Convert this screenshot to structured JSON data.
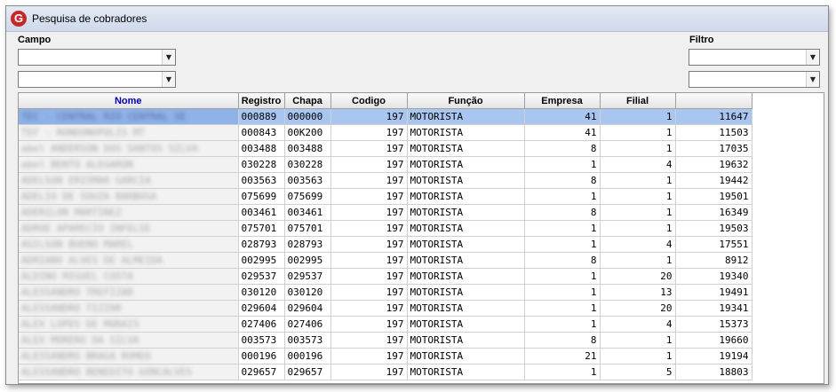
{
  "window": {
    "title": "Pesquisa de cobradores",
    "app_icon": "G"
  },
  "filters": {
    "campo_label": "Campo",
    "filtro_label": "Filtro",
    "campo_value_1": "",
    "campo_value_2": "",
    "filtro_value_1": "",
    "filtro_value_2": ""
  },
  "table": {
    "headers": [
      "Nome",
      "Registro",
      "Chapa",
      "Codigo",
      "Função",
      "Empresa",
      "Filial",
      ""
    ],
    "selected_row": 0,
    "rows": [
      {
        "nome": "TEC - CENTRAL RIO CENTRAL SE",
        "registro": "000889",
        "chapa": "000000",
        "codigo": "197",
        "funcao": "MOTORISTA",
        "empresa": "41",
        "filial": "1",
        "extra": "11647"
      },
      {
        "nome": "TEF - RONDONOPOLIS MT",
        "registro": "000843",
        "chapa": "00K200",
        "codigo": "197",
        "funcao": "MOTORISTA",
        "empresa": "41",
        "filial": "1",
        "extra": "11503"
      },
      {
        "nome": "abel ANDERSON DOS SANTOS SILVA",
        "registro": "003488",
        "chapa": "003488",
        "codigo": "197",
        "funcao": "MOTORISTA",
        "empresa": "8",
        "filial": "1",
        "extra": "17035"
      },
      {
        "nome": "abel BENTO ALEGARON",
        "registro": "030228",
        "chapa": "030228",
        "codigo": "197",
        "funcao": "MOTORISTA",
        "empresa": "1",
        "filial": "4",
        "extra": "19632"
      },
      {
        "nome": "ADELSON ERISMAR GARCIA",
        "registro": "003563",
        "chapa": "003563",
        "codigo": "197",
        "funcao": "MOTORISTA",
        "empresa": "8",
        "filial": "1",
        "extra": "19442"
      },
      {
        "nome": "ADELIO DE SOUZA BARBOSA",
        "registro": "075699",
        "chapa": "075699",
        "codigo": "197",
        "funcao": "MOTORISTA",
        "empresa": "1",
        "filial": "1",
        "extra": "19501"
      },
      {
        "nome": "ADERILON MARTINEZ",
        "registro": "003461",
        "chapa": "003461",
        "codigo": "197",
        "funcao": "MOTORISTA",
        "empresa": "8",
        "filial": "1",
        "extra": "16349"
      },
      {
        "nome": "ADROE APARECIO INFELSE",
        "registro": "075701",
        "chapa": "075701",
        "codigo": "197",
        "funcao": "MOTORISTA",
        "empresa": "1",
        "filial": "1",
        "extra": "19503"
      },
      {
        "nome": "AGILSON BUENO MAREL",
        "registro": "028793",
        "chapa": "028793",
        "codigo": "197",
        "funcao": "MOTORISTA",
        "empresa": "1",
        "filial": "4",
        "extra": "17551"
      },
      {
        "nome": "ADRIANO ALVES DE ALMEIDA",
        "registro": "002995",
        "chapa": "002995",
        "codigo": "197",
        "funcao": "MOTORISTA",
        "empresa": "8",
        "filial": "1",
        "extra": "8912"
      },
      {
        "nome": "ALDINO MIGUEL COSTA",
        "registro": "029537",
        "chapa": "029537",
        "codigo": "197",
        "funcao": "MOTORISTA",
        "empresa": "1",
        "filial": "20",
        "extra": "19340"
      },
      {
        "nome": "ALESSANDRO TREFIZAR",
        "registro": "030120",
        "chapa": "030120",
        "codigo": "197",
        "funcao": "MOTORISTA",
        "empresa": "1",
        "filial": "13",
        "extra": "19491"
      },
      {
        "nome": "ALESSANDRO TIZZAR",
        "registro": "029604",
        "chapa": "029604",
        "codigo": "197",
        "funcao": "MOTORISTA",
        "empresa": "1",
        "filial": "20",
        "extra": "19341"
      },
      {
        "nome": "ALEX LOPES DE MORAIS",
        "registro": "027406",
        "chapa": "027406",
        "codigo": "197",
        "funcao": "MOTORISTA",
        "empresa": "1",
        "filial": "4",
        "extra": "15373"
      },
      {
        "nome": "ALEX MORERO DA SILVA",
        "registro": "003573",
        "chapa": "003573",
        "codigo": "197",
        "funcao": "MOTORISTA",
        "empresa": "8",
        "filial": "1",
        "extra": "19660"
      },
      {
        "nome": "ALESSANDRO BRAGA ROMEO",
        "registro": "000196",
        "chapa": "000196",
        "codigo": "197",
        "funcao": "MOTORISTA",
        "empresa": "21",
        "filial": "1",
        "extra": "19194"
      },
      {
        "nome": "ALESSANDRO BENEDITO GONCALVES",
        "registro": "029657",
        "chapa": "029657",
        "codigo": "197",
        "funcao": "MOTORISTA",
        "empresa": "1",
        "filial": "5",
        "extra": "18803"
      }
    ]
  }
}
